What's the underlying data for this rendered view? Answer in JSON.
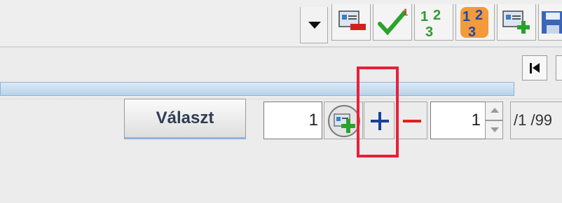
{
  "toolbar": {
    "dropdown_icon": "chevron-down-icon",
    "buttons": [
      {
        "name": "remove-record-icon"
      },
      {
        "name": "checkmark-icon"
      },
      {
        "name": "numbering-123-icon"
      },
      {
        "name": "numbering-123-orange-icon"
      },
      {
        "name": "add-record-icon"
      },
      {
        "name": "save-icon"
      }
    ]
  },
  "navigation": {
    "first_icon": "first-page-icon"
  },
  "bottom_bar": {
    "select_label": "Választ",
    "count_value": "1",
    "add_icon": "add-row-icon",
    "plus_symbol": "+",
    "minus_symbol": "−",
    "page_value": "1",
    "page_total": "/1 /99"
  },
  "colors": {
    "highlight": "#e8203a",
    "plus": "#1b3f9c",
    "minus": "#e02020",
    "button_text": "#2f3d55"
  }
}
